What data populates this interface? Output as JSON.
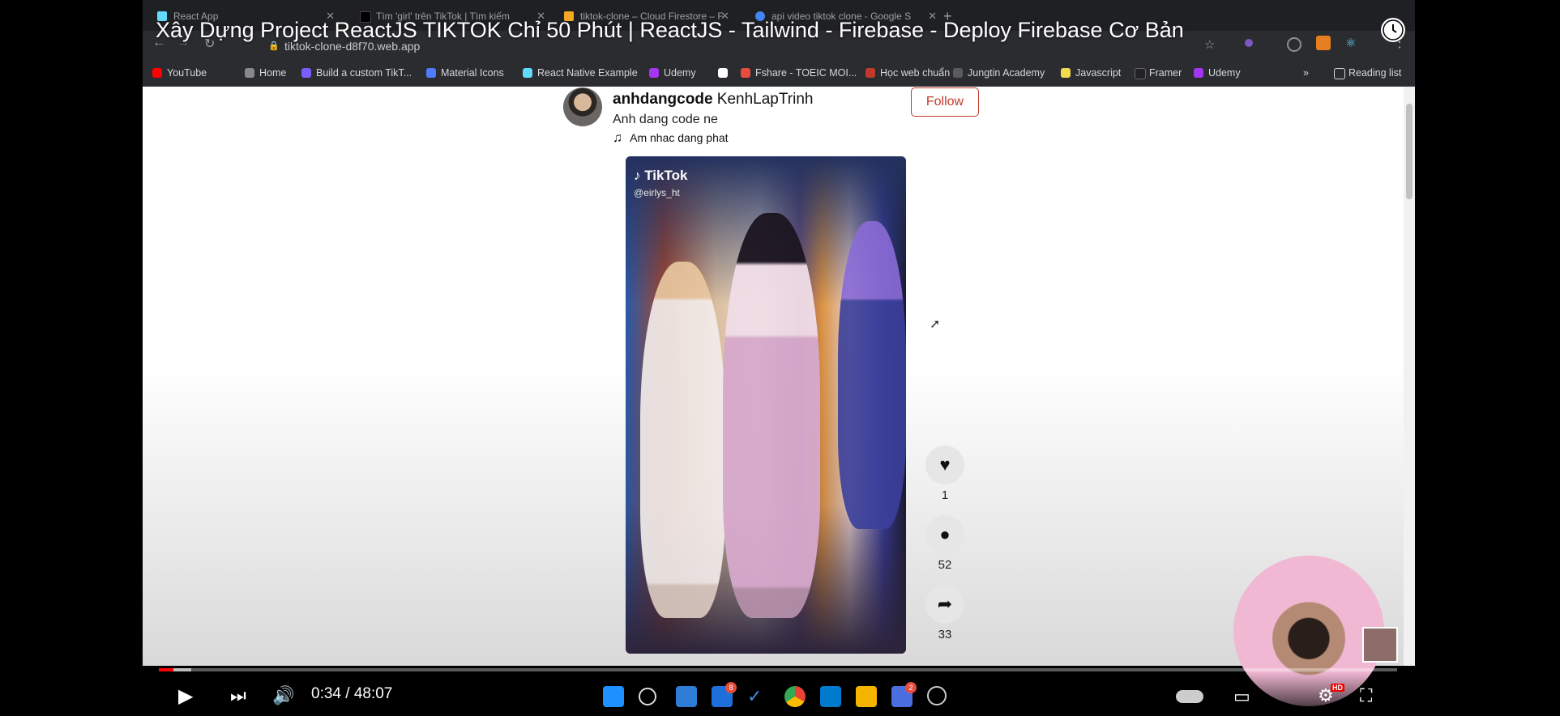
{
  "video_title": "Xây Dựng Project ReactJS TIKTOK Chỉ 50 Phút | ReactJS - Tailwind - Firebase - Deploy Firebase Cơ Bản",
  "browser": {
    "tabs": [
      {
        "label": "React App",
        "color": "#61dafb"
      },
      {
        "label": "Tìm 'girl' trên TikTok | Tìm kiếm",
        "color": "#000000"
      },
      {
        "label": "tiktok-clone – Cloud Firestore – F",
        "color": "#f5a623"
      },
      {
        "label": "api video tiktok clone - Google S",
        "color": "#4285f4"
      }
    ],
    "url": "tiktok-clone-d8f70.web.app",
    "bookmarks": [
      {
        "label": "YouTube",
        "color": "#ff0000"
      },
      {
        "label": "Home",
        "color": "#888888"
      },
      {
        "label": "Build a custom TikT...",
        "color": "#7b5cff"
      },
      {
        "label": "Material Icons",
        "color": "#4f7cff"
      },
      {
        "label": "React Native Example",
        "color": "#61dafb"
      },
      {
        "label": "Udemy",
        "color": "#a435f0"
      },
      {
        "label": "Fshare - TOEIC MOI...",
        "color": "#e74c3c"
      },
      {
        "label": "Học web chuẩn",
        "color": "#c0392b"
      },
      {
        "label": "Jungtin Academy",
        "color": "#5b5b5b"
      },
      {
        "label": "Javascript",
        "color": "#f0db4f"
      },
      {
        "label": "Framer",
        "color": "#222222"
      },
      {
        "label": "Udemy",
        "color": "#a435f0"
      }
    ],
    "reading_list": "Reading list",
    "more_bookmarks": "»"
  },
  "post": {
    "username": "anhdangcode",
    "display_name": "KenhLapTrinh",
    "caption": "Anh dang code ne",
    "music": "Am nhac dang phat",
    "follow_label": "Follow",
    "video_watermark": "TikTok",
    "video_handle": "@eirlys_ht",
    "likes": "1",
    "comments": "52",
    "shares": "33"
  },
  "player": {
    "time": "0:34 / 48:07",
    "hd_badge": "HD",
    "progress": 0.012
  },
  "taskbar_badges": {
    "calendar": "8",
    "chat": "2"
  },
  "colors": {
    "follow": "#c0392b",
    "progress": "#ff0000"
  }
}
